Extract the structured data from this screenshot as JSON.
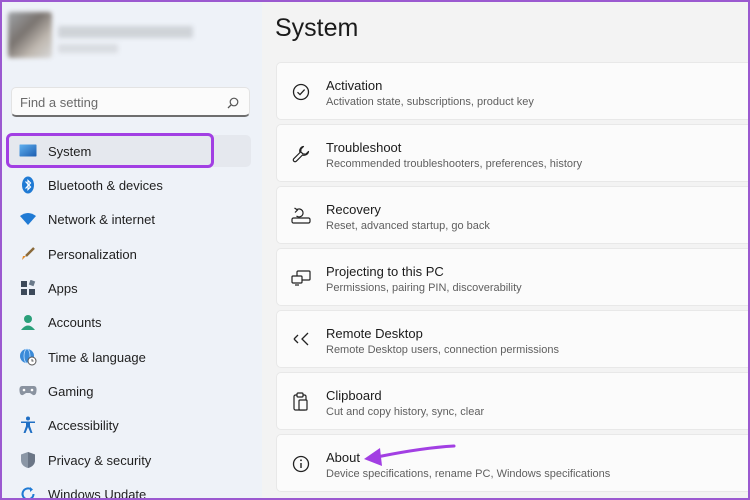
{
  "search": {
    "placeholder": "Find a setting"
  },
  "sidebar": {
    "items": [
      {
        "label": "System",
        "icon": "system-display-icon",
        "active": true
      },
      {
        "label": "Bluetooth & devices",
        "icon": "bluetooth-icon"
      },
      {
        "label": "Network & internet",
        "icon": "wifi-icon"
      },
      {
        "label": "Personalization",
        "icon": "brush-icon"
      },
      {
        "label": "Apps",
        "icon": "apps-icon"
      },
      {
        "label": "Accounts",
        "icon": "accounts-icon"
      },
      {
        "label": "Time & language",
        "icon": "globe-clock-icon"
      },
      {
        "label": "Gaming",
        "icon": "gamepad-icon"
      },
      {
        "label": "Accessibility",
        "icon": "accessibility-icon"
      },
      {
        "label": "Privacy & security",
        "icon": "shield-icon"
      },
      {
        "label": "Windows Update",
        "icon": "update-icon"
      }
    ]
  },
  "main": {
    "title": "System",
    "cards": [
      {
        "title": "Activation",
        "subtitle": "Activation state, subscriptions, product key",
        "icon": "activation-check-icon"
      },
      {
        "title": "Troubleshoot",
        "subtitle": "Recommended troubleshooters, preferences, history",
        "icon": "wrench-icon"
      },
      {
        "title": "Recovery",
        "subtitle": "Reset, advanced startup, go back",
        "icon": "recovery-icon"
      },
      {
        "title": "Projecting to this PC",
        "subtitle": "Permissions, pairing PIN, discoverability",
        "icon": "projecting-icon"
      },
      {
        "title": "Remote Desktop",
        "subtitle": "Remote Desktop users, connection permissions",
        "icon": "remote-desktop-icon"
      },
      {
        "title": "Clipboard",
        "subtitle": "Cut and copy history, sync, clear",
        "icon": "clipboard-icon"
      },
      {
        "title": "About",
        "subtitle": "Device specifications, rename PC, Windows specifications",
        "icon": "info-icon"
      }
    ]
  },
  "colors": {
    "highlight": "#a23fe3",
    "accent": "#0067c0",
    "arrow": "#a23fe3"
  }
}
